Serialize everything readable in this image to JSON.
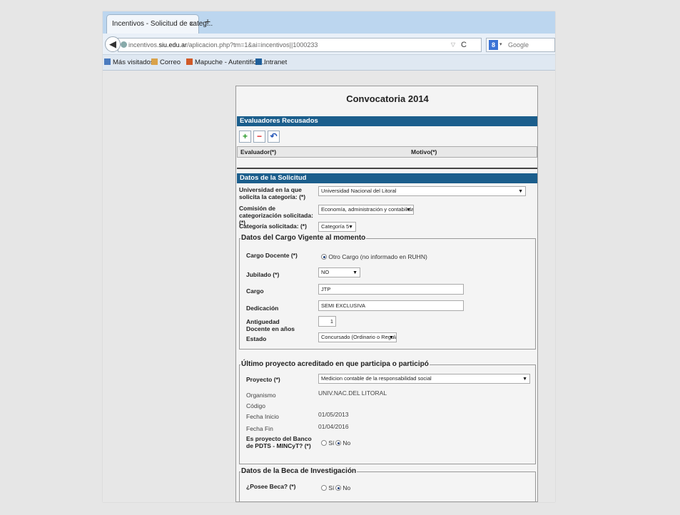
{
  "browser": {
    "tab_title": "Incentivos - Solicitud de categ...",
    "tab_close": "x",
    "new_tab": "+",
    "url_prefix": "incentivos.",
    "url_domain": "siu.edu.ar",
    "url_path": "/aplicacion.php?tm=1&ai=incentivos||1000233",
    "search_placeholder": "Google",
    "search_logo": "8"
  },
  "bookmarks": [
    {
      "label": "Más visitados",
      "icon": "bookmark-icon",
      "color": "#4a7bbf"
    },
    {
      "label": "Correo",
      "icon": "mail-icon",
      "color": "#d9a24a"
    },
    {
      "label": "Mapuche - Autentifica...",
      "icon": "siu-icon",
      "color": "#d05a28"
    },
    {
      "label": "Intranet",
      "icon": "intranet-icon",
      "color": "#1f5f9a"
    }
  ],
  "page": {
    "title": "Convocatoria 2014",
    "evaluadores": {
      "header": "Evaluadores Recusados",
      "col_evaluador": "Evaluador(*)",
      "col_motivo": "Motivo(*)"
    },
    "solicitud": {
      "header": "Datos de la Solicitud",
      "universidad_label": "Universidad en la que solicita la categoría: (*)",
      "universidad_value": "Universidad Nacional del Litoral",
      "comision_label": "Comisión de categorización solicitada: (*)",
      "comision_value": "Economía, administración y contabilidad",
      "categoria_label": "Categoría solicitada: (*)",
      "categoria_value": "Categoría 5"
    },
    "cargo": {
      "legend": "Datos del Cargo Vigente al momento",
      "docente_label": "Cargo Docente (*)",
      "docente_option": "Otro Cargo (no informado en RUHN)",
      "jubilado_label": "Jubilado (*)",
      "jubilado_value": "NO",
      "cargo_label": "Cargo",
      "cargo_value": "JTP",
      "dedicacion_label": "Dedicación",
      "dedicacion_value": "SEMI EXCLUSIVA",
      "antiguedad_label": "Antiguedad Docente en años",
      "antiguedad_value": "1",
      "estado_label": "Estado",
      "estado_value": "Concursado (Ordinario o Regular)"
    },
    "proyecto": {
      "legend": "Último proyecto acreditado en que participa o participó",
      "proyecto_label": "Proyecto (*)",
      "proyecto_value": "Medicion contable de la responsabilidad social",
      "organismo_label": "Organismo",
      "organismo_value": "UNIV.NAC.DEL LITORAL",
      "codigo_label": "Código",
      "fecha_inicio_label": "Fecha Inicio",
      "fecha_inicio_value": "01/05/2013",
      "fecha_fin_label": "Fecha Fin",
      "fecha_fin_value": "01/04/2016",
      "pdts_label": "Es proyecto del Banco de PDTS - MINCyT? (*)",
      "opt_si": "Sí",
      "opt_no": "No"
    },
    "beca": {
      "legend": "Datos de la Beca de Investigación",
      "posee_label": "¿Posee Beca? (*)",
      "opt_si": "Sí",
      "opt_no": "No"
    }
  }
}
